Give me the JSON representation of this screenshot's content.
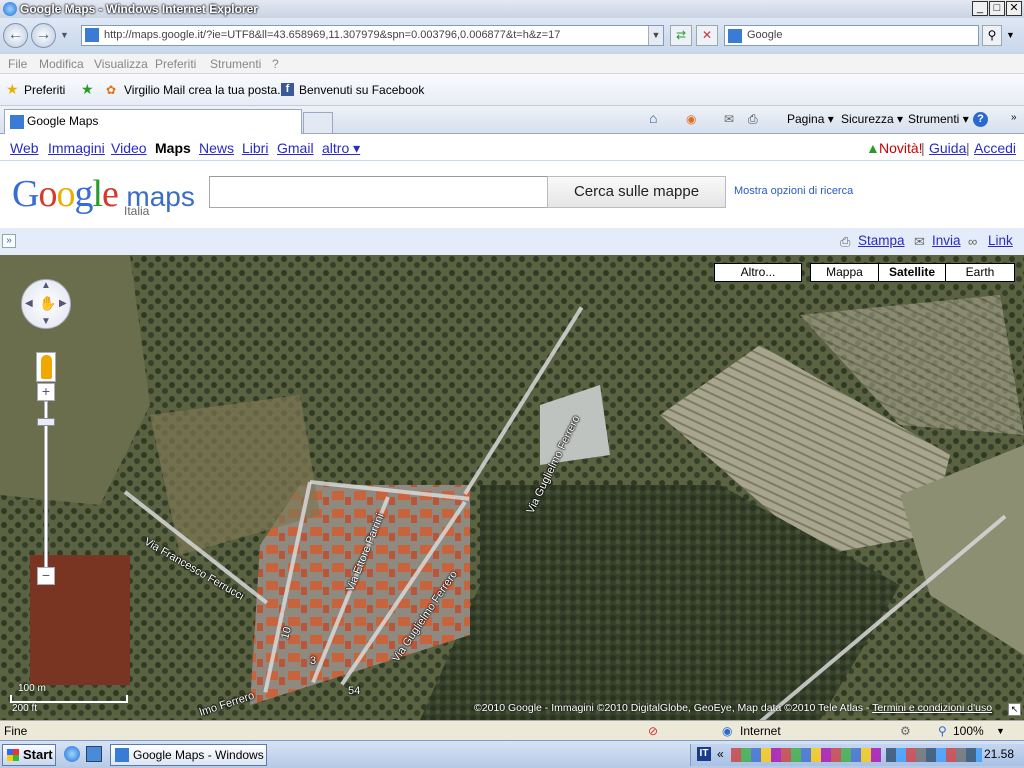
{
  "window": {
    "title": "Google Maps - Windows Internet Explorer"
  },
  "address_bar": {
    "url": "http://maps.google.it/?ie=UTF8&ll=43.658969,11.307979&spn=0.003796,0.006877&t=h&z=17",
    "search_placeholder": "Google"
  },
  "menu": {
    "items": [
      "File",
      "Modifica",
      "Visualizza",
      "Preferiti",
      "Strumenti",
      "?"
    ]
  },
  "favorites": {
    "label": "Preferiti",
    "items": [
      "Virgilio Mail crea la tua posta...",
      "Benvenuti su Facebook"
    ]
  },
  "tabs": {
    "active": "Google Maps",
    "tools": [
      "Pagina",
      "Sicurezza",
      "Strumenti"
    ]
  },
  "gbar": {
    "links": [
      "Web",
      "Immagini",
      "Video",
      "Maps",
      "News",
      "Libri",
      "Gmail",
      "altro ▾"
    ],
    "active": "Maps",
    "novita": "Novità!",
    "guida": "Guida",
    "accedi": "Accedi"
  },
  "logo": {
    "text_google": "Google",
    "text_maps": "maps",
    "sub": "Italia"
  },
  "search": {
    "button": "Cerca sulle mappe",
    "options": "Mostra opzioni di ricerca"
  },
  "linkbar": {
    "stampa": "Stampa",
    "invia": "Invia",
    "link": "Link"
  },
  "map": {
    "types": {
      "altro": "Altro...",
      "mappa": "Mappa",
      "satellite": "Satellite",
      "earth": "Earth",
      "active": "Satellite"
    },
    "roads": [
      "Via Guglielmo Ferrero",
      "Via Ettore Parrini",
      "Via Guglielmo Ferrero",
      "Via Francesco Ferrucci",
      "lmo Ferrero"
    ],
    "house_numbers": [
      "10",
      "3",
      "54"
    ],
    "scale": {
      "metric": "100 m",
      "imperial": "200 ft"
    },
    "copyright": "©2010 Google - Immagini ©2010 DigitalGlobe, GeoEye, Map data ©2010 Tele Atlas - ",
    "terms": "Termini e condizioni d'uso"
  },
  "status": {
    "text": "Fine",
    "zone": "Internet",
    "zoom": "100%"
  },
  "taskbar": {
    "start": "Start",
    "task": "Google Maps - Windows ...",
    "clock": "21.58"
  }
}
